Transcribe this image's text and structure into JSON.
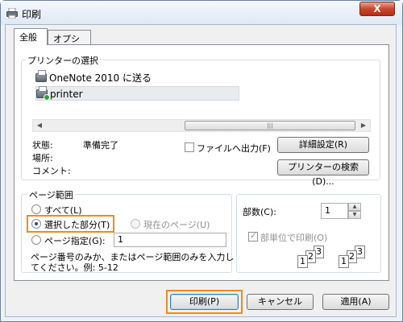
{
  "window": {
    "title": "印刷",
    "close_label": "X"
  },
  "tabs": [
    {
      "label": "全般"
    },
    {
      "label": "オプション"
    }
  ],
  "printer_select": {
    "group_label": "プリンターの選択",
    "printers": [
      {
        "name": "OneNote 2010 に送る",
        "icon": "printer-icon"
      },
      {
        "name": "printer",
        "icon": "printer-default-icon"
      }
    ]
  },
  "status": {
    "state_label": "状態:",
    "state_value": "準備完了",
    "location_label": "場所:",
    "comment_label": "コメント:",
    "print_to_file_label": "ファイルへ出力(F)",
    "preferences_button": "詳細設定(R)",
    "find_printer_button": "プリンターの検索(D)..."
  },
  "page_range": {
    "group_label": "ページ範囲",
    "all_label": "すべて(L)",
    "selection_label": "選択した部分(T)",
    "current_page_label": "現在のページ(U)",
    "pages_label": "ページ指定(G):",
    "pages_value": "1",
    "hint_line1": "ページ番号のみか、またはページ範囲のみを入力し",
    "hint_line2": "てください。例: 5-12"
  },
  "copies": {
    "copies_label": "部数(C):",
    "copies_value": "1",
    "collate_label": "部単位で印刷(O)",
    "collate_pages": [
      "1",
      "2",
      "3",
      "1",
      "2",
      "3"
    ]
  },
  "buttons": {
    "print": "印刷(P)",
    "cancel": "キャンセル",
    "apply": "適用(A)"
  },
  "colors": {
    "highlight": "#f08a1c",
    "accent": "#3c7fb1"
  }
}
